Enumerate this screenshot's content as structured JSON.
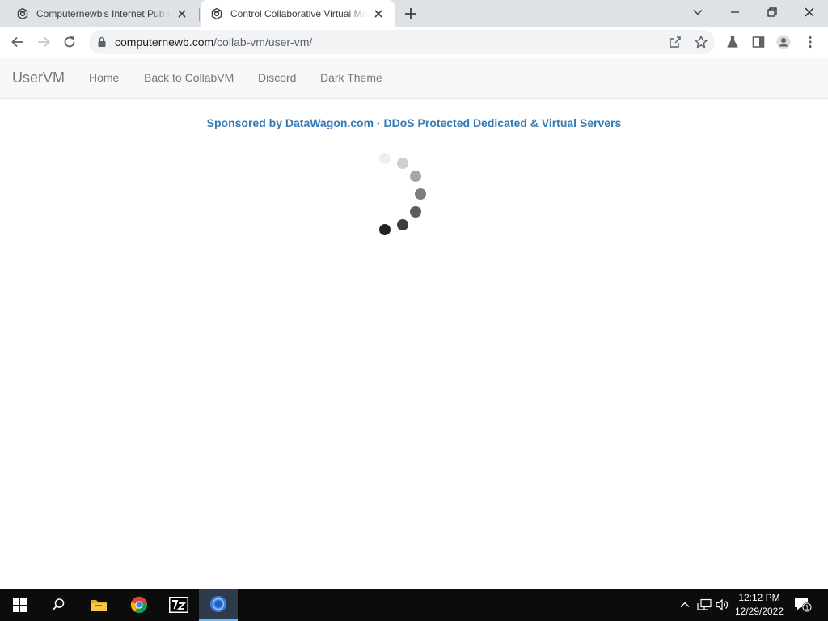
{
  "browser": {
    "tabs": [
      {
        "title": "Computernewb's Internet Pub Hub"
      },
      {
        "title": "Control Collaborative Virtual Machines"
      }
    ],
    "url_host": "computernewb.com",
    "url_path": "/collab-vm/user-vm/"
  },
  "navbar": {
    "brand": "UserVM",
    "links": [
      "Home",
      "Back to CollabVM",
      "Discord",
      "Dark Theme"
    ]
  },
  "sponsor_text": "Sponsored by DataWagon.com · DDoS Protected Dedicated & Virtual Servers",
  "taskbar": {
    "time": "12:12 PM",
    "date": "12/29/2022",
    "notification_count": "1",
    "apps": [
      "start-icon",
      "search-icon",
      "file-explorer-icon",
      "chrome-icon",
      "7zip-icon",
      "chrome-active-icon"
    ]
  },
  "colors": {
    "tabstrip_bg": "#dee1e6",
    "link_blue": "#337ab7",
    "nav_text": "#777777",
    "taskbar_bg": "#0c0c0c"
  }
}
